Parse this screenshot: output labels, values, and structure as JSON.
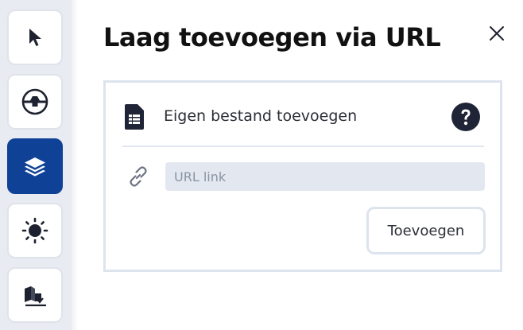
{
  "toolbar": {
    "buttons": [
      {
        "name": "select-tool",
        "icon": "cursor-arrow-icon",
        "active": false
      },
      {
        "name": "measure-tool",
        "icon": "terrain-tool-icon",
        "active": false
      },
      {
        "name": "layers-tool",
        "icon": "layers-icon",
        "active": true
      },
      {
        "name": "sun-tool",
        "icon": "sun-icon",
        "active": false
      },
      {
        "name": "export-tool",
        "icon": "export-download-icon",
        "active": false
      }
    ],
    "active_color": "#0f4296"
  },
  "panel": {
    "title": "Laag toevoegen via URL",
    "close_icon": "close-icon",
    "file_label": "Eigen bestand toevoegen",
    "file_icon": "spreadsheet-file-icon",
    "help_icon": "help-circle-icon",
    "url_placeholder": "URL link",
    "url_value": "",
    "link_icon": "link-icon",
    "add_label": "Toevoegen"
  }
}
